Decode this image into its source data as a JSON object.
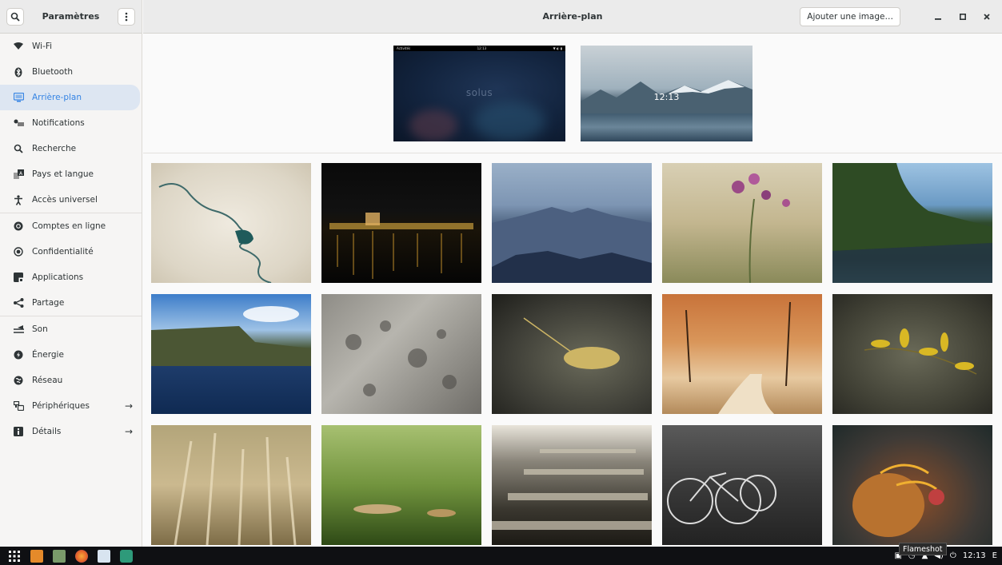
{
  "sidebar": {
    "title": "Paramètres",
    "items": [
      {
        "label": "Wi-Fi",
        "icon": "wifi-icon"
      },
      {
        "label": "Bluetooth",
        "icon": "bluetooth-icon"
      },
      {
        "label": "Arrière-plan",
        "icon": "background-icon",
        "active": true
      },
      {
        "label": "Notifications",
        "icon": "notifications-icon"
      },
      {
        "label": "Recherche",
        "icon": "search-icon"
      },
      {
        "label": "Pays et langue",
        "icon": "language-icon"
      },
      {
        "label": "Accès universel",
        "icon": "accessibility-icon"
      },
      {
        "label": "Comptes en ligne",
        "icon": "online-accounts-icon"
      },
      {
        "label": "Confidentialité",
        "icon": "privacy-icon"
      },
      {
        "label": "Applications",
        "icon": "applications-icon"
      },
      {
        "label": "Partage",
        "icon": "share-icon"
      },
      {
        "label": "Son",
        "icon": "sound-icon"
      },
      {
        "label": "Énergie",
        "icon": "power-icon"
      },
      {
        "label": "Réseau",
        "icon": "network-icon"
      },
      {
        "label": "Périphériques",
        "icon": "devices-icon",
        "arrow": true
      },
      {
        "label": "Détails",
        "icon": "details-icon",
        "arrow": true
      }
    ]
  },
  "header": {
    "title": "Arrière-plan",
    "add_image": "Ajouter une image…"
  },
  "preview": {
    "lock_brand": "solus",
    "lock_topbar_left": "Activités",
    "lock_topbar_time": "12:13",
    "desktop_clock": "12:13"
  },
  "wallpapers": [
    {
      "name": "satellite-river"
    },
    {
      "name": "night-city-lake"
    },
    {
      "name": "blue-mountains"
    },
    {
      "name": "purple-flower"
    },
    {
      "name": "forest-lake"
    },
    {
      "name": "cliffs-sea"
    },
    {
      "name": "rock-texture"
    },
    {
      "name": "fallen-leaf-road"
    },
    {
      "name": "autumn-park"
    },
    {
      "name": "yellow-leaves"
    },
    {
      "name": "wheat-field"
    },
    {
      "name": "grass-leaf"
    },
    {
      "name": "railway-track"
    },
    {
      "name": "bicycles"
    },
    {
      "name": "hermit-crab"
    }
  ],
  "taskbar": {
    "time": "12:13",
    "tooltip": "Flameshot"
  },
  "colors": {
    "accent": "#3584e4",
    "active_bg": "#dde6f2",
    "taskbar": "#0f1013"
  }
}
